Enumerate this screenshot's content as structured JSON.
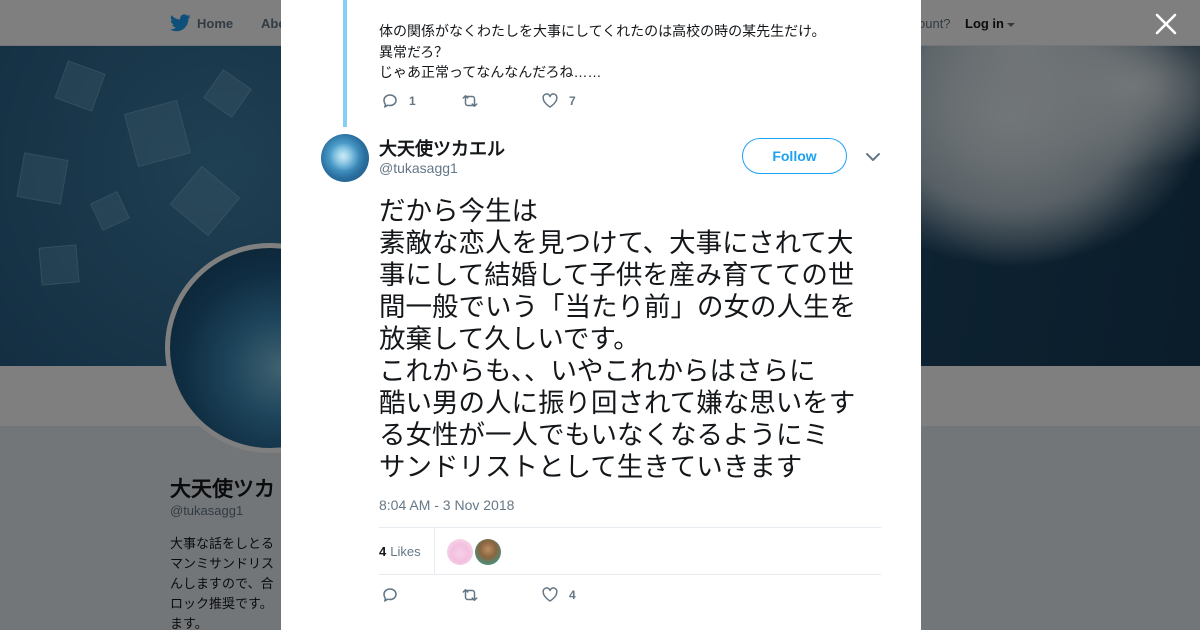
{
  "topbar": {
    "home_label": "Home",
    "about_label": "Abo",
    "account_prompt": "ccount?",
    "login_label": "Log in"
  },
  "profile": {
    "name": "大天使ツカ",
    "handle": "@tukasagg1",
    "bio_lines": [
      "大事な話をしとる",
      "マンミサンドリス",
      "んしますので、合",
      "ロック推奨です。",
      "ます。"
    ]
  },
  "modal": {
    "previous_tweet": {
      "lines": [
        "体の関係がなくわたしを大事にしてくれたのは高校の時の某先生だけ。",
        "異常だろ？",
        "じゃあ正常ってなんなんだろね……"
      ],
      "reply_count": "1",
      "retweet_count": "",
      "like_count": "7"
    },
    "tweet": {
      "author_name": "大天使ツカエル",
      "author_handle": "@tukasagg1",
      "follow_label": "Follow",
      "text_lines": [
        "だから今生は",
        "素敵な恋人を見つけて、大事にされて大",
        "事にして結婚して子供を産み育てての世",
        "間一般でいう「当たり前」の女の人生を",
        "放棄して久しいです。",
        "これからも、、いやこれからはさらに",
        "酷い男の人に振り回されて嫌な思いをす",
        "る女性が一人でもいなくなるようにミ",
        "サンドリストとして生きていきます"
      ],
      "timestamp": "8:04 AM - 3 Nov 2018",
      "likes_count": "4",
      "likes_label": "Likes",
      "reply_count": "",
      "retweet_count": "",
      "like_count": "4"
    }
  },
  "colors": {
    "accent": "#1da1f2",
    "thread_line": "#87cdf5",
    "secondary_text": "#657786"
  }
}
